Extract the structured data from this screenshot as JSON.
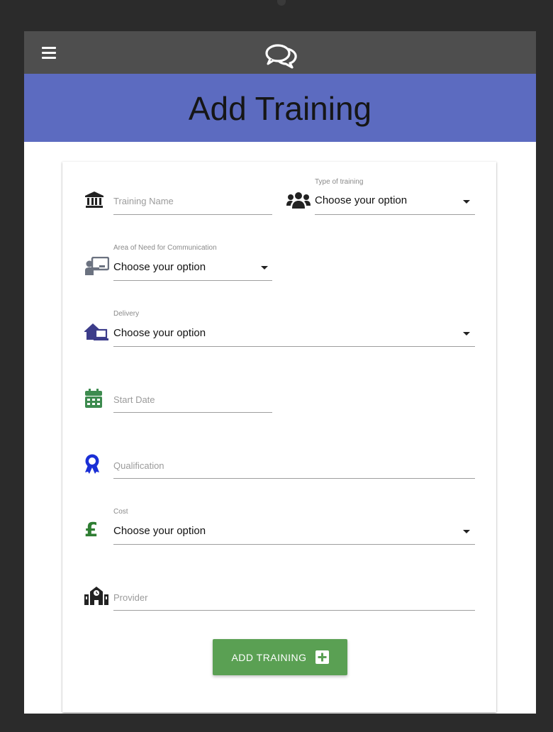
{
  "header": {
    "title": "Add Training",
    "menu_icon": "hamburger-menu-icon",
    "logo_icon": "chat-bubbles-icon"
  },
  "form": {
    "training_name": {
      "placeholder": "Training Name",
      "icon": "bank-building-icon"
    },
    "type_of_training": {
      "label": "Type of training",
      "value": "Choose your option",
      "icon": "users-group-icon"
    },
    "area_of_need": {
      "label": "Area of Need for Communication",
      "value": "Choose your option",
      "icon": "chalkboard-teacher-icon"
    },
    "delivery": {
      "label": "Delivery",
      "value": "Choose your option",
      "icon": "house-laptop-icon"
    },
    "start_date": {
      "placeholder": "Start Date",
      "icon": "calendar-icon"
    },
    "qualification": {
      "placeholder": "Qualification",
      "icon": "award-ribbon-icon"
    },
    "cost": {
      "label": "Cost",
      "value": "Choose your option",
      "icon": "pound-sign-icon"
    },
    "provider": {
      "placeholder": "Provider",
      "icon": "school-building-icon"
    }
  },
  "actions": {
    "add_label": "ADD TRAINING",
    "add_icon": "plus-square-icon"
  },
  "colors": {
    "navbar": "#4e4e4e",
    "header_band": "#5c6bc0",
    "button": "#5aa053",
    "calendar_icon": "#3d8b4f",
    "award_icon": "#1a2fd6",
    "pound_icon": "#2e7d32",
    "house_icon": "#3c3c8a"
  }
}
